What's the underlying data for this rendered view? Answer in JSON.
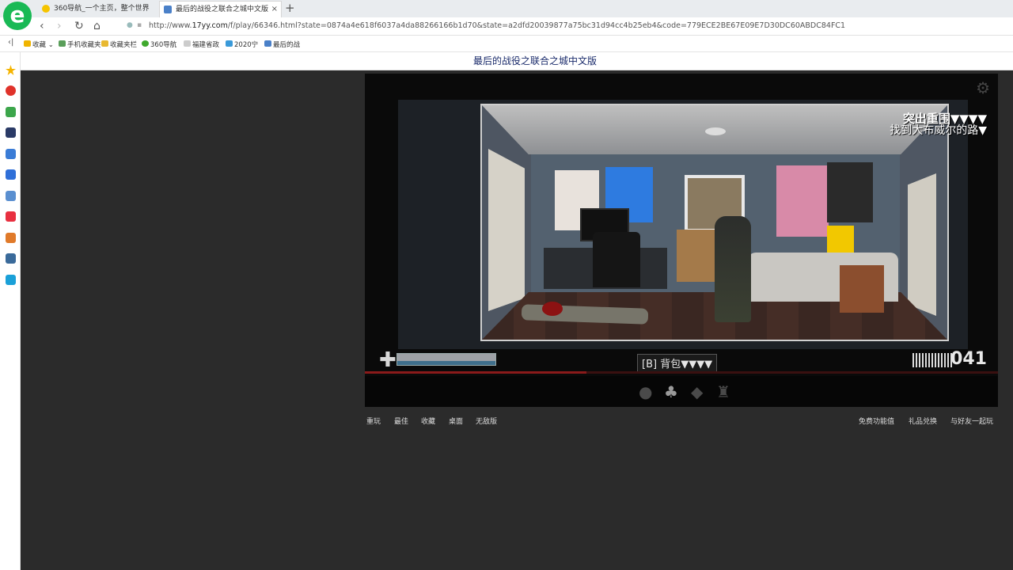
{
  "browser": {
    "logo": "e",
    "tabs": [
      {
        "label": "360导航_一个主页，整个世界",
        "active": false
      },
      {
        "label": "最后的战役之联合之城中文版",
        "active": true
      }
    ],
    "tab_close": "×",
    "new_tab": "+",
    "url_prefix": "http://www.",
    "url_domain": "17yy.com",
    "url_rest": "/f/play/66346.html?state=0874a4e618f6037a4da88266166b1d70&state=a2dfd20039877a75bc31d94cc4b25eb4&code=779ECE2BE67E09E7D30DC60ABDC84FC1",
    "bookmarks": [
      "收藏",
      "手机收藏夹",
      "收藏夹栏",
      "360导航",
      "福建省政",
      "2020宁",
      "最后的战"
    ]
  },
  "page": {
    "title": "最后的战役之联合之城中文版"
  },
  "game": {
    "objective_title": "突出重围▼▼▼▼",
    "objective_sub": "找到大布威尔的路▼",
    "ammo": "041",
    "health_fraction": 1.0,
    "progress_fraction": 0.35,
    "tooltip": "[B] 背包▼▼▼▼",
    "toolbar_icons": [
      "head-icon",
      "backpack-icon",
      "notebook-icon",
      "trophy-icon"
    ]
  },
  "links_left": [
    "重玩",
    "最佳",
    "收藏",
    "桌面",
    "无敌版"
  ],
  "links_right": [
    "免费功能值",
    "礼品兑换",
    "与好友一起玩"
  ],
  "colors": {
    "accent": "#19b955",
    "title_text": "#1a2b6b",
    "background": "#2b2b2b"
  }
}
